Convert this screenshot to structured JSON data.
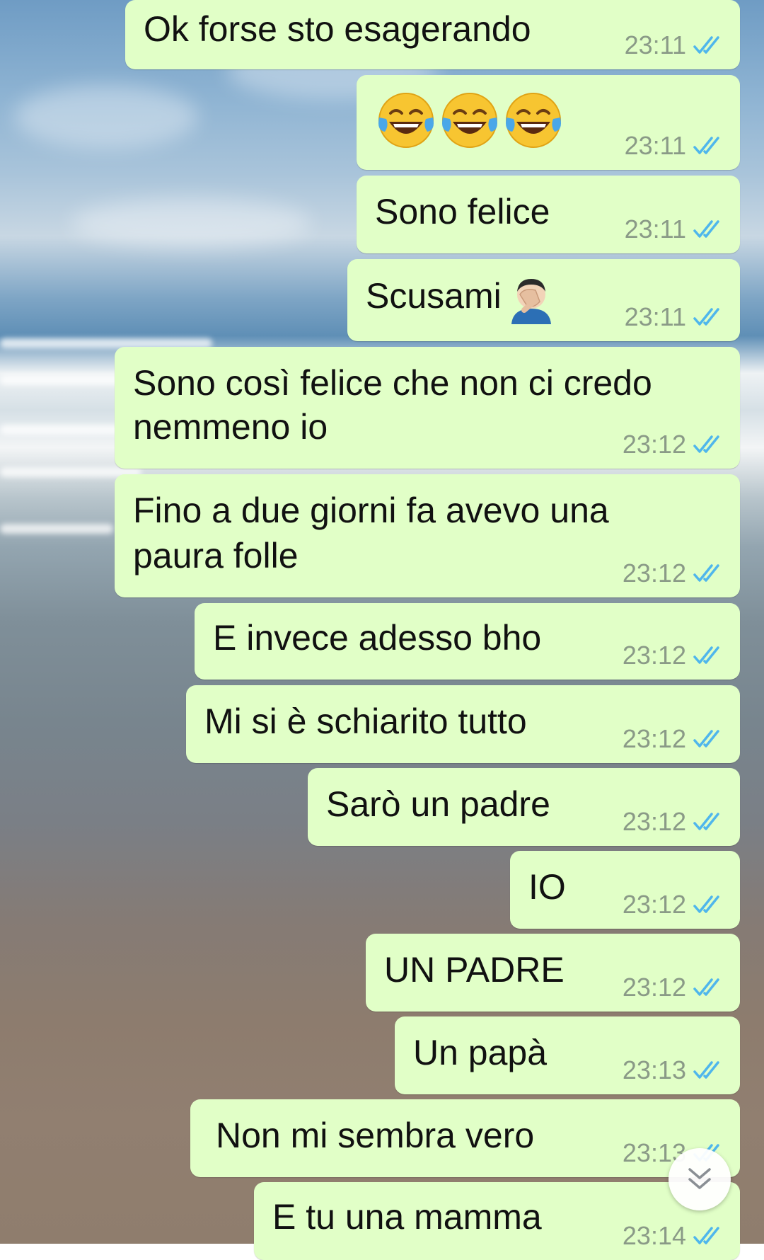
{
  "messages": [
    {
      "text": "Ok forse sto esagerando",
      "time": "23:11"
    },
    {
      "text": "",
      "emoji": [
        "tears-of-joy",
        "tears-of-joy",
        "tears-of-joy"
      ],
      "time": "23:11"
    },
    {
      "text": "Sono felice",
      "time": "23:11"
    },
    {
      "text": "Scusami",
      "emoji_after": "facepalm",
      "time": "23:11"
    },
    {
      "text_lines": [
        "Sono così felice che non ci credo",
        "nemmeno io"
      ],
      "time": "23:12"
    },
    {
      "text_lines": [
        "Fino a due giorni fa avevo una",
        "paura folle"
      ],
      "time": "23:12"
    },
    {
      "text": "E invece adesso bho",
      "time": "23:12"
    },
    {
      "text": "Mi si è schiarito tutto",
      "time": "23:12"
    },
    {
      "text": "Sarò un padre",
      "time": "23:12"
    },
    {
      "text": "IO",
      "time": "23:12"
    },
    {
      "text": "UN PADRE",
      "time": "23:12"
    },
    {
      "text": "Un papà",
      "time": "23:13"
    },
    {
      "text": "Non mi sembra vero",
      "time": "23:13"
    },
    {
      "text": "E tu una mamma",
      "time": "23:14"
    }
  ],
  "status_icon": "double-check-read-icon",
  "scroll_button_icon": "chevron-double-down-icon",
  "colors": {
    "bubble": "#e1ffc7",
    "tick": "#4fb6ec",
    "time": "#8a9a87"
  }
}
